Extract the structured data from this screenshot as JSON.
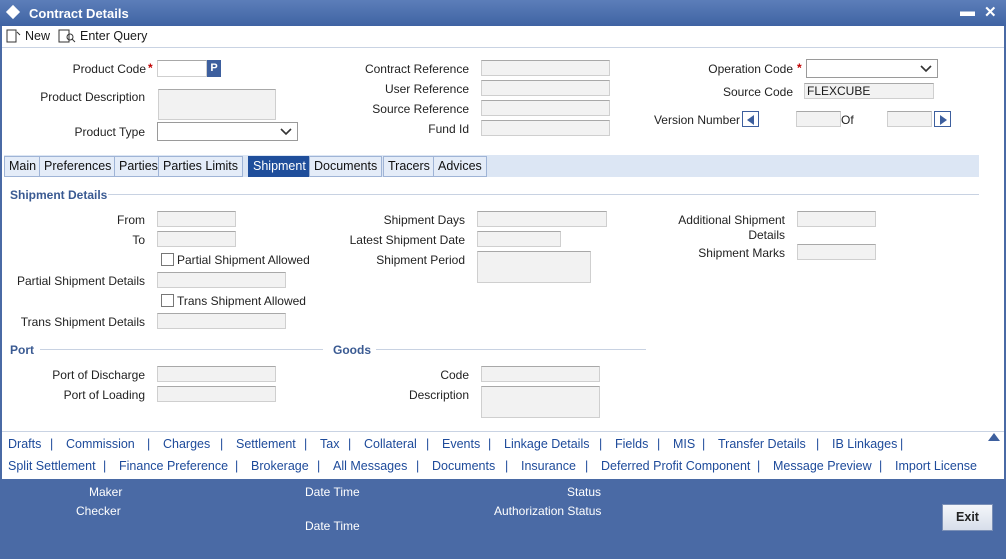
{
  "window": {
    "title": "Contract Details",
    "minimize_glyph": "▬",
    "close_glyph": "✕"
  },
  "toolbar": {
    "new_label": "New",
    "enter_query_label": "Enter Query"
  },
  "header": {
    "product_code_label": "Product Code",
    "product_code_lov": "P",
    "product_description_label": "Product Description",
    "product_type_label": "Product Type",
    "contract_reference_label": "Contract Reference",
    "user_reference_label": "User Reference",
    "source_reference_label": "Source Reference",
    "fund_id_label": "Fund Id",
    "operation_code_label": "Operation Code",
    "source_code_label": "Source Code",
    "source_code_value": "FLEXCUBE",
    "version_number_label": "Version Number",
    "of_label": "Of",
    "required_mark": "*"
  },
  "tabs": [
    {
      "label": "Main"
    },
    {
      "label": "Preferences"
    },
    {
      "label": "Parties"
    },
    {
      "label": "Parties Limits"
    },
    {
      "label": "Shipment",
      "active": true
    },
    {
      "label": "Documents"
    },
    {
      "label": "Tracers"
    },
    {
      "label": "Advices"
    }
  ],
  "shipment": {
    "section_title": "Shipment Details",
    "from_label": "From",
    "to_label": "To",
    "partial_allowed_label": "Partial Shipment Allowed",
    "partial_details_label": "Partial Shipment Details",
    "trans_allowed_label": "Trans Shipment Allowed",
    "trans_details_label": "Trans Shipment Details",
    "days_label": "Shipment Days",
    "latest_date_label": "Latest Shipment Date",
    "period_label": "Shipment Period",
    "additional_details_label_1": "Additional Shipment",
    "additional_details_label_2": "Details",
    "marks_label": "Shipment Marks"
  },
  "port": {
    "section_title": "Port",
    "discharge_label": "Port of Discharge",
    "loading_label": "Port of Loading"
  },
  "goods": {
    "section_title": "Goods",
    "code_label": "Code",
    "description_label": "Description"
  },
  "links_row1": [
    "Drafts",
    "Commission",
    "Charges",
    "Settlement",
    "Tax",
    "Collateral",
    "Events",
    "Linkage Details",
    "Fields",
    "MIS",
    "Transfer Details",
    "IB Linkages"
  ],
  "links_row2": [
    "Split Settlement",
    "Finance Preference",
    "Brokerage",
    "All Messages",
    "Documents",
    "Insurance",
    "Deferred Profit Component",
    "Message Preview",
    "Import License"
  ],
  "link_separator": "|",
  "footer": {
    "maker_label": "Maker",
    "checker_label": "Checker",
    "date_time_label_1": "Date Time",
    "date_time_label_2": "Date Time",
    "status_label": "Status",
    "authorization_status_label": "Authorization Status",
    "exit_label": "Exit"
  },
  "colors": {
    "accent": "#4a6aa5",
    "active_tab": "#1f4e9b",
    "link": "#1d4a9a",
    "required": "#c00000"
  }
}
